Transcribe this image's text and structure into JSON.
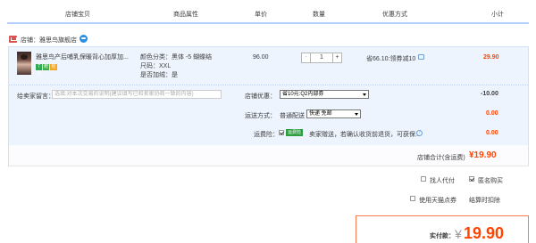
{
  "columns": [
    "店铺宝贝",
    "商品属性",
    "单价",
    "数量",
    "优惠方式",
    "小计"
  ],
  "shop": {
    "prefix": "店铺：",
    "name": "雅思鸟旗舰店"
  },
  "item": {
    "title": "雅思鸟产后哺乳保暖背心加厚加...",
    "badges": [
      "7天",
      "赠",
      "险"
    ],
    "attrs": [
      "颜色分类：黑体 -5 蝴蝶结",
      "尺码：XXL",
      "是否加绒：是"
    ],
    "price": "96.00",
    "qty": {
      "minus": "-",
      "value": "1",
      "plus": "+"
    },
    "discount": "省66.10:领券减10",
    "subtotal": "29.90"
  },
  "message": {
    "label": "给卖家留言：",
    "placeholder": "选填:对本次交易的说明(建议填写已和卖家协商一致的内容)"
  },
  "shop_discount": {
    "label": "店铺优惠：",
    "selected": "省10元:Q2内部券",
    "amount": "-10.00"
  },
  "shipping": {
    "label": "运送方式：",
    "method": "普通配送",
    "selected": "快递 免邮",
    "amount": "0.00"
  },
  "insurance": {
    "label": "运费险：",
    "tag": "运费险",
    "text": "卖家赠送，若确认收货前退货，可获保...",
    "amount": "0.00"
  },
  "store_total": {
    "label": "店铺合计(含运费)",
    "amount": "¥19.90"
  },
  "options": {
    "anonymous_pay": "找人代付",
    "anonymous_buy": "匿名购买",
    "tmall_points": "使用天猫点券",
    "points_hint": "结算时扣除"
  },
  "payment": {
    "label": "实付款：",
    "amount": "19.90",
    "currency": "¥"
  },
  "colors": {
    "accent": "#ff4400",
    "border": "#b2d1ff",
    "tag_green": "#2c9e40"
  }
}
